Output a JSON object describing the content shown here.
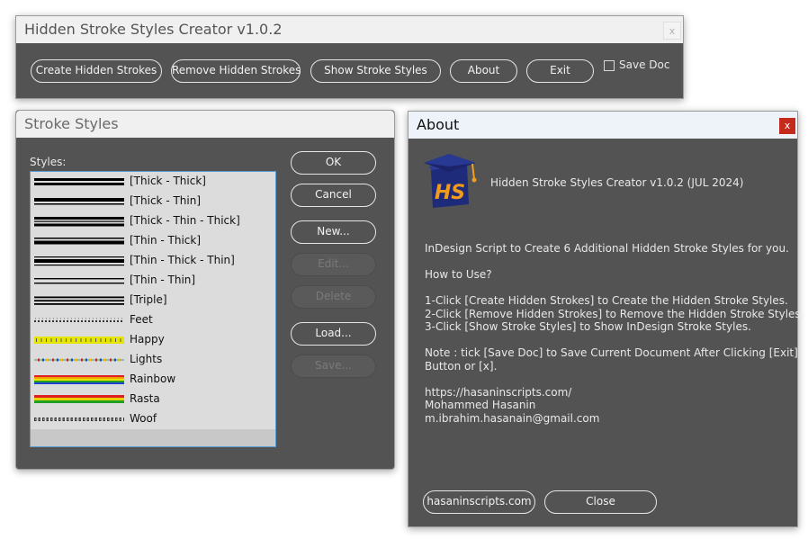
{
  "main_window": {
    "title": "Hidden Stroke Styles Creator v1.0.2",
    "close": "x",
    "buttons": [
      "Create Hidden Strokes",
      "Remove Hidden Strokes",
      "Show Stroke Styles",
      "About",
      "Exit"
    ],
    "save_doc_label": "Save Doc",
    "save_doc_checked": false
  },
  "stroke_styles": {
    "title": "Stroke Styles",
    "list_label": "Styles:",
    "items": [
      {
        "label": "[Thick - Thick]",
        "swatch": "thick-thick"
      },
      {
        "label": "[Thick - Thin]",
        "swatch": "thick-thin"
      },
      {
        "label": "[Thick - Thin - Thick]",
        "swatch": "thick-thin-thick"
      },
      {
        "label": "[Thin - Thick]",
        "swatch": "thin-thick"
      },
      {
        "label": "[Thin - Thick - Thin]",
        "swatch": "thin-thick-thin"
      },
      {
        "label": "[Thin - Thin]",
        "swatch": "thin-thin"
      },
      {
        "label": "[Triple]",
        "swatch": "triple"
      },
      {
        "label": "Feet",
        "swatch": "feet"
      },
      {
        "label": "Happy",
        "swatch": "happy"
      },
      {
        "label": "Lights",
        "swatch": "lights"
      },
      {
        "label": "Rainbow",
        "swatch": "rainbow"
      },
      {
        "label": "Rasta",
        "swatch": "rasta"
      },
      {
        "label": "Woof",
        "swatch": "woof"
      }
    ],
    "buttons": {
      "ok": "OK",
      "cancel": "Cancel",
      "new": "New...",
      "edit": "Edit...",
      "delete": "Delete",
      "load": "Load...",
      "save": "Save..."
    }
  },
  "about": {
    "title": "About",
    "close": "x",
    "logo_letters": "HS",
    "heading": "Hidden Stroke Styles Creator v1.0.2 (JUL 2024)",
    "lines": [
      "InDesign Script to Create 6 Additional Hidden Stroke Styles for you.",
      "How to Use?",
      "1-Click [Create Hidden Strokes] to Create the Hidden Stroke Styles.",
      "2-Click [Remove Hidden Strokes] to Remove the Hidden Stroke Styles.",
      "3-Click [Show Stroke Styles] to Show InDesign Stroke Styles.",
      "Note : tick [Save Doc] to Save Current Document After Clicking [Exit]",
      "Button or [x].",
      "https://hasaninscripts.com/",
      "Mohammed Hasanin",
      "m.ibrahim.hasanain@gmail.com"
    ],
    "website_button": "hasaninscripts.com",
    "close_button": "Close"
  },
  "colors": {
    "dialog_bg": "#535353",
    "titlebar_bg": "#f0f0f0",
    "about_titlebar_bg": "#eef3fa",
    "close_red": "#c42b1c",
    "list_selection_border": "#5b9bd5"
  }
}
